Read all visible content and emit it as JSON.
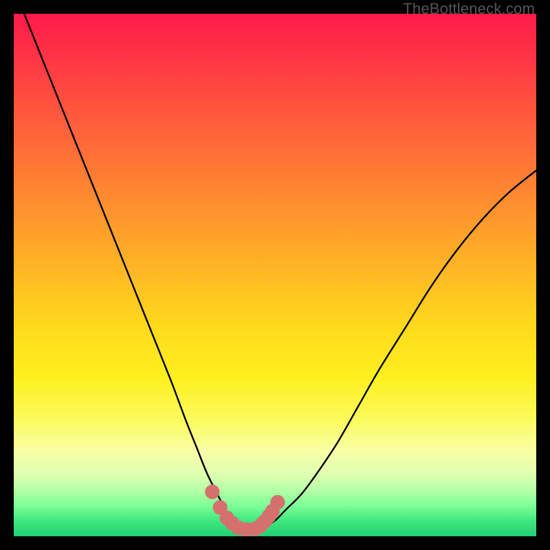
{
  "watermark": "TheBottleneck.com",
  "chart_data": {
    "type": "line",
    "title": "",
    "xlabel": "",
    "ylabel": "",
    "xlim": [
      0,
      100
    ],
    "ylim": [
      0,
      100
    ],
    "grid": false,
    "axes_visible": false,
    "background_gradient": [
      "#ff1a4a",
      "#ff9a2c",
      "#ffda1c",
      "#fbfb60",
      "#20d070"
    ],
    "series": [
      {
        "name": "bottleneck-curve",
        "color": "#000000",
        "x": [
          2,
          6,
          10,
          14,
          18,
          22,
          26,
          30,
          33,
          35,
          37,
          39,
          40,
          41,
          42,
          43,
          44,
          45,
          46,
          47,
          48,
          50,
          52,
          55,
          58,
          62,
          66,
          70,
          75,
          80,
          85,
          90,
          95,
          100
        ],
        "y": [
          100,
          90,
          80,
          70,
          60,
          50,
          40,
          30,
          22,
          17,
          12,
          8,
          6,
          4,
          3,
          2,
          1.5,
          1.3,
          1.3,
          1.5,
          2,
          3,
          5,
          8,
          12,
          18,
          25,
          32,
          40,
          48,
          55,
          61,
          66,
          70
        ]
      }
    ],
    "markers": {
      "name": "optimal-region",
      "color": "#d6706e",
      "radius": 1.4,
      "x": [
        38,
        39.5,
        40.8,
        41.8,
        43,
        44.5,
        46.2,
        47.2,
        48,
        48.8,
        49.5,
        50.5
      ],
      "y": [
        8.5,
        5.5,
        3.5,
        2.5,
        1.6,
        1.3,
        1.4,
        2.0,
        2.8,
        3.8,
        4.8,
        6.5
      ]
    }
  }
}
